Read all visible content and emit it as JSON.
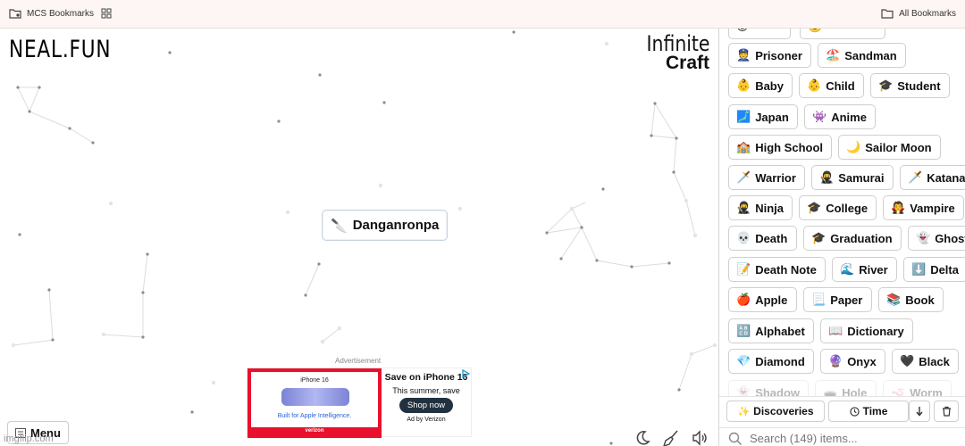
{
  "bookmarks_bar": {
    "left_label": "MCS Bookmarks",
    "right_label": "All Bookmarks"
  },
  "logo": {
    "neal": "NEAL.FUN",
    "infinite_line1": "Infinite",
    "infinite_line2": "Craft"
  },
  "canvas_item": {
    "emoji": "🔪",
    "label": "Danganronpa"
  },
  "ad": {
    "label": "Advertisement",
    "product": "iPhone 16",
    "built_for": "Built for Apple Intelligence.",
    "brand": "verizon",
    "headline": "Save on iPhone 16",
    "sub": "This summer, save",
    "cta": "Shop now",
    "by": "Ad by Verizon"
  },
  "menu_label": "Menu",
  "watermark": "imgflip.com",
  "sidebar": {
    "items": [
      {
        "emoji": "👮",
        "label": "Prisoner",
        "faded": false
      },
      {
        "emoji": "🏖️",
        "label": "Sandman",
        "faded": false
      },
      {
        "emoji": "👶",
        "label": "Baby",
        "faded": false
      },
      {
        "emoji": "👶",
        "label": "Child",
        "faded": false
      },
      {
        "emoji": "🎓",
        "label": "Student",
        "faded": false
      },
      {
        "emoji": "🗾",
        "label": "Japan",
        "faded": false
      },
      {
        "emoji": "👾",
        "label": "Anime",
        "faded": false
      },
      {
        "emoji": "🏫",
        "label": "High School",
        "faded": false
      },
      {
        "emoji": "🌙",
        "label": "Sailor Moon",
        "faded": false
      },
      {
        "emoji": "🗡️",
        "label": "Warrior",
        "faded": false
      },
      {
        "emoji": "🥷",
        "label": "Samurai",
        "faded": false
      },
      {
        "emoji": "🗡️",
        "label": "Katana",
        "faded": false
      },
      {
        "emoji": "🥷",
        "label": "Ninja",
        "faded": false
      },
      {
        "emoji": "🎓",
        "label": "College",
        "faded": false
      },
      {
        "emoji": "🧛",
        "label": "Vampire",
        "faded": false
      },
      {
        "emoji": "💀",
        "label": "Death",
        "faded": false
      },
      {
        "emoji": "🎓",
        "label": "Graduation",
        "faded": false
      },
      {
        "emoji": "👻",
        "label": "Ghost",
        "faded": false
      },
      {
        "emoji": "📝",
        "label": "Death Note",
        "faded": false
      },
      {
        "emoji": "🌊",
        "label": "River",
        "faded": false
      },
      {
        "emoji": "⬇️",
        "label": "Delta",
        "faded": false
      },
      {
        "emoji": "🍎",
        "label": "Apple",
        "faded": false
      },
      {
        "emoji": "📃",
        "label": "Paper",
        "faded": false
      },
      {
        "emoji": "📚",
        "label": "Book",
        "faded": false
      },
      {
        "emoji": "🔠",
        "label": "Alphabet",
        "faded": false
      },
      {
        "emoji": "📖",
        "label": "Dictionary",
        "faded": false
      },
      {
        "emoji": "💎",
        "label": "Diamond",
        "faded": false
      },
      {
        "emoji": "🔮",
        "label": "Onyx",
        "faded": false
      },
      {
        "emoji": "🖤",
        "label": "Black",
        "faded": false
      },
      {
        "emoji": "👻",
        "label": "Shadow",
        "faded": true
      },
      {
        "emoji": "🕳️",
        "label": "Hole",
        "faded": true
      },
      {
        "emoji": "🪱",
        "label": "Worm",
        "faded": true
      }
    ],
    "discoveries_label": "Discoveries",
    "time_label": "Time",
    "search_placeholder": "Search (149) items..."
  }
}
